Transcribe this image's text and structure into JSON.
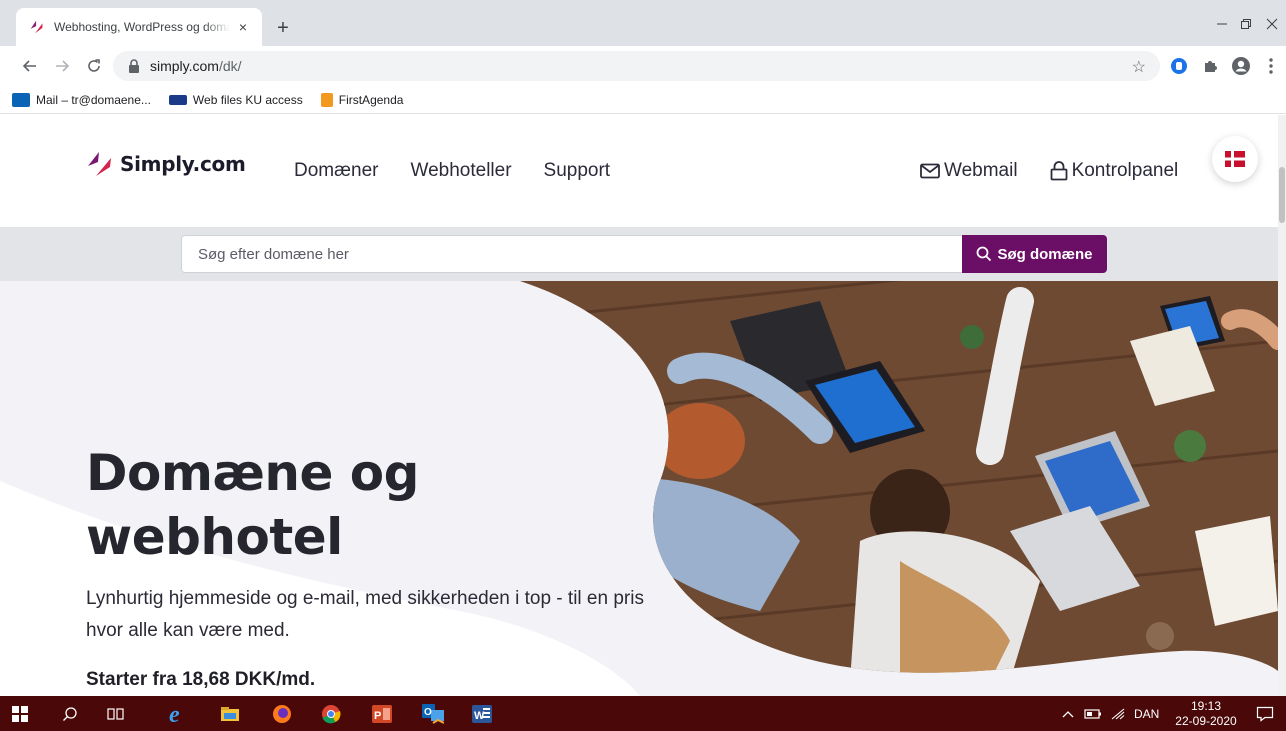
{
  "browser": {
    "tab_title": "Webhosting, WordPress og domæne",
    "tab_close": "×",
    "new_tab": "+",
    "url_host": "simply.com",
    "url_path": "/dk/",
    "bookmarks": [
      {
        "label": "Mail – tr@domaene..."
      },
      {
        "label": "Web files KU access"
      },
      {
        "label": "FirstAgenda"
      }
    ]
  },
  "site": {
    "logo": "Simply.com",
    "nav": [
      "Domæner",
      "Webhoteller",
      "Support"
    ],
    "webmail": "Webmail",
    "control_panel": "Kontrolpanel",
    "search": {
      "placeholder": "Søg efter domæne her",
      "button": "Søg domæne"
    },
    "hero": {
      "title_line1": "Domæne og",
      "title_line2": "webhotel",
      "subtitle": "Lynhurtig hjemmeside og e-mail, med sikkerheden i top - til en pris hvor alle kan være med.",
      "price": "Starter fra 18,68 DKK/md."
    }
  },
  "taskbar": {
    "lang": "DAN",
    "time": "19:13",
    "date": "22-09-2020"
  },
  "colors": {
    "brand_purple": "#6b0e66",
    "taskbar": "#4a0908",
    "search_band": "#e2e4e8"
  }
}
